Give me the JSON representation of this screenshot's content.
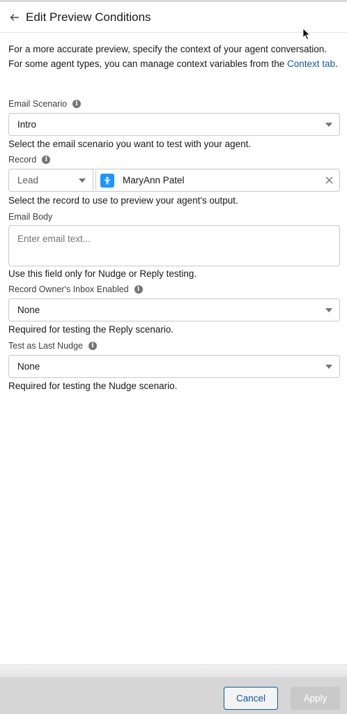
{
  "header": {
    "title": "Edit Preview Conditions"
  },
  "intro": {
    "text_before": "For a more accurate preview, specify the context of your agent conversation. For some agent types, you can manage context variables from the ",
    "link": "Context tab",
    "text_after": "."
  },
  "email_scenario": {
    "label": "Email Scenario",
    "value": "Intro",
    "help": "Select the email scenario you want to test with your agent."
  },
  "record": {
    "label": "Record",
    "type_value": "Lead",
    "selected": "MaryAnn Patel",
    "help": "Select the record to use to preview your agent's output."
  },
  "email_body": {
    "label": "Email Body",
    "placeholder": "Enter email text...",
    "help": "Use this field only for Nudge or Reply testing."
  },
  "inbox_enabled": {
    "label": "Record Owner's Inbox Enabled",
    "value": "None",
    "help": "Required for testing the Reply scenario."
  },
  "last_nudge": {
    "label": "Test as Last Nudge",
    "value": "None",
    "help": "Required for testing the Nudge scenario."
  },
  "footer": {
    "cancel_label": "Cancel",
    "apply_label": "Apply"
  },
  "colors": {
    "link": "#0b5cab",
    "lead_icon": "#1b96ff",
    "border": "#c9c9c9"
  }
}
